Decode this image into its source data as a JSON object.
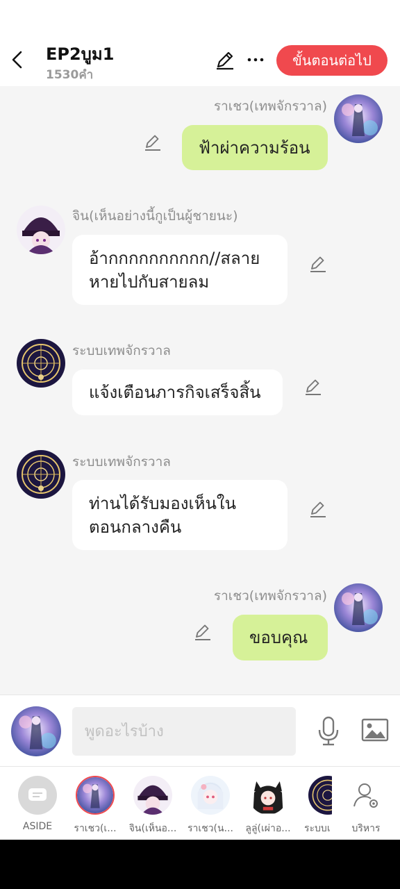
{
  "header": {
    "title": "EP2บูม1",
    "subtitle": "1530คำ",
    "next_label": "ขั้นตอนต่อไป"
  },
  "messages": [
    {
      "side": "right",
      "name": "ราเชว(เทพจักรวาล)",
      "text": "ฟ้าผ่าความร้อน",
      "avatar": "raceo"
    },
    {
      "side": "left",
      "name": "จิน(เห็นอย่างนี้กูเป็นผู้ชายนะ)",
      "text": "อ้ากกกกกกกกกก//สลาย หายไปกับสายลม",
      "avatar": "jin"
    },
    {
      "side": "left",
      "name": "ระบบเทพจักรวาล",
      "text": "แจ้งเตือนภารกิจเสร็จสิ้น",
      "avatar": "system"
    },
    {
      "side": "left",
      "name": "ระบบเทพจักรวาล",
      "text": "ท่านได้รับมองเห็นใน ตอนกลางคืน",
      "avatar": "system"
    },
    {
      "side": "right",
      "name": "ราเชว(เทพจักรวาล)",
      "text": "ขอบคุณ",
      "avatar": "raceo"
    }
  ],
  "input": {
    "placeholder": "พูดอะไรบ้าง"
  },
  "characters": [
    {
      "label": "ASIDE",
      "avatar": "aside"
    },
    {
      "label": "ราเชว(เ...",
      "avatar": "raceo",
      "selected": true
    },
    {
      "label": "จิน(เห็นอ...",
      "avatar": "jin"
    },
    {
      "label": "ราเชว(น...",
      "avatar": "white"
    },
    {
      "label": "ลูลู่(เผ่าอ...",
      "avatar": "lulu"
    },
    {
      "label": "ระบบเ",
      "avatar": "system"
    },
    {
      "label": "บริหาร",
      "avatar": "manage-icon"
    }
  ],
  "colors": {
    "accent_red": "#f0494e",
    "bubble_green": "#d6f198",
    "chat_bg": "#f5f5f5"
  }
}
